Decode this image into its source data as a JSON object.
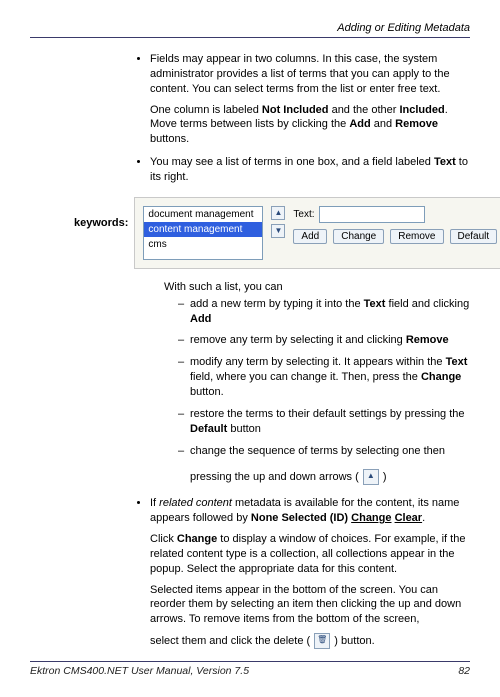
{
  "header": {
    "title": "Adding or Editing Metadata"
  },
  "bullets": {
    "b1_text": "Fields may appear in two columns. In this case, the system administrator provides a list of terms that you can apply to the content. You can select terms from the list or enter free text.",
    "b1_p2_pre": "One column is labeled ",
    "b1_p2_notincluded": "Not Included",
    "b1_p2_mid": " and the other ",
    "b1_p2_included": "Included",
    "b1_p2_post": ". Move terms between lists by clicking the ",
    "b1_p2_add": "Add",
    "b1_p2_and": " and ",
    "b1_p2_remove": "Remove",
    "b1_p2_end": " buttons.",
    "b2_pre": "You may see a list of terms in one box, and a field labeled ",
    "b2_text": "Text",
    "b2_post": " to its right."
  },
  "keywords": {
    "label": "keywords:",
    "options": [
      "document management",
      "content management",
      "cms"
    ],
    "selected_index": 1,
    "text_label": "Text:",
    "text_value": "",
    "buttons": {
      "add": "Add",
      "change": "Change",
      "remove": "Remove",
      "default": "Default"
    }
  },
  "after_box": {
    "with_such": "With such a list, you can",
    "d1_pre": "add a new term by typing it into the ",
    "d1_text": "Text",
    "d1_mid": " field and clicking ",
    "d1_add": "Add",
    "d2_pre": "remove any term by selecting it and clicking ",
    "d2_remove": "Remove",
    "d3_pre": "modify any term by selecting it. It appears within the ",
    "d3_text": "Text",
    "d3_mid": " field, where you can change it. Then, press the ",
    "d3_change": "Change",
    "d3_end": " button.",
    "d4_pre": "restore the terms to their default settings by pressing the ",
    "d4_default": "Default",
    "d4_end": " button",
    "d5_line1": "change the sequence of terms by selecting one then",
    "d5_line2_pre": "pressing the up and down arrows ( ",
    "d5_line2_post": " )"
  },
  "related": {
    "pre": "If ",
    "rc": "related content",
    "mid": " metadata is available for the content, its name appears followed by ",
    "none_sel": "None Selected (ID) ",
    "change": "Change",
    "sp": " ",
    "clear": "Clear",
    "dot": ".",
    "p2_pre": "Click ",
    "p2_change": "Change",
    "p2_rest": " to display a window of choices. For example, if the related content type is a collection, all collections appear in the popup. Select the appropriate data for this content.",
    "p3": "Selected items appear in the bottom of the screen. You can reorder them by selecting an item then clicking the up and down arrows. To remove items from the bottom of the screen,",
    "p4_pre": "select them and click the delete ( ",
    "p4_post": " ) button."
  },
  "footer": {
    "left": "Ektron CMS400.NET User Manual, Version 7.5",
    "right": "82"
  }
}
